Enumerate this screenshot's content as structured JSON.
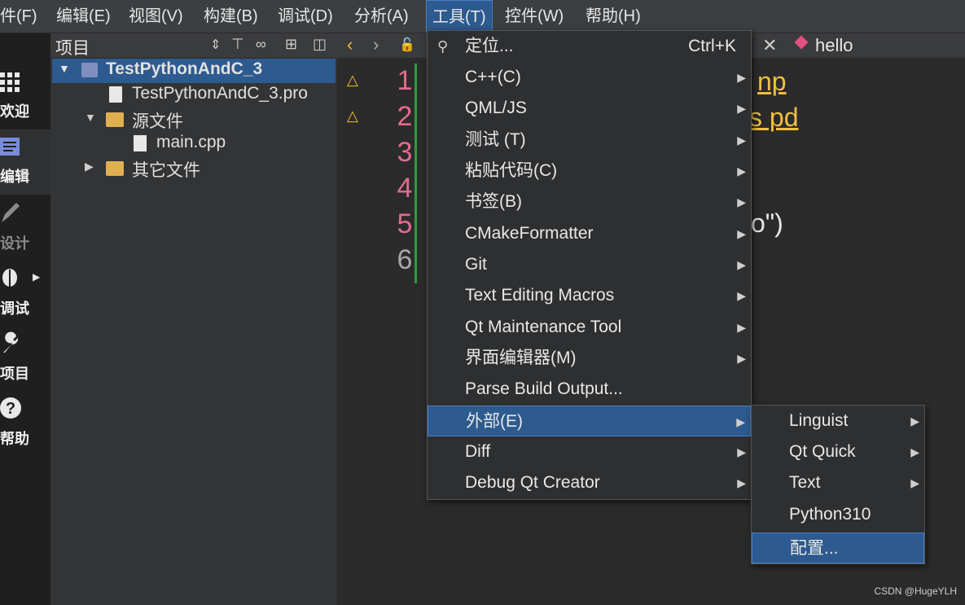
{
  "menubar": {
    "items": [
      "件(F)",
      "编辑(E)",
      "视图(V)",
      "构建(B)",
      "调试(D)",
      "分析(A)",
      "工具(T)",
      "控件(W)",
      "帮助(H)"
    ],
    "active": "工具(T)"
  },
  "modes": [
    "欢迎",
    "编辑",
    "设计",
    "调试",
    "项目",
    "帮助"
  ],
  "project_panel": {
    "title": "项目",
    "tree": [
      {
        "label": "TestPythonAndC_3",
        "level": 0,
        "icon": "project-folder-icon"
      },
      {
        "label": "TestPythonAndC_3.pro",
        "level": 1,
        "icon": "qt-file-icon"
      },
      {
        "label": "源文件",
        "level": 1,
        "icon": "source-folder-icon"
      },
      {
        "label": "main.cpp",
        "level": 2,
        "icon": "file-icon"
      },
      {
        "label": "其它文件",
        "level": 1,
        "icon": "other-folder-icon"
      }
    ]
  },
  "editor": {
    "tab_title": "hello",
    "line_numbers": [
      "1",
      "2",
      "3",
      "4",
      "5",
      "6"
    ],
    "code_fragments": [
      "np",
      "s  pd",
      "o\")"
    ]
  },
  "tools_menu": {
    "items": [
      {
        "label": "定位...",
        "shortcut": "Ctrl+K",
        "submenu": false
      },
      {
        "label": "C++(C)",
        "submenu": true
      },
      {
        "label": "QML/JS",
        "submenu": true
      },
      {
        "label": "测试 (T)",
        "submenu": true
      },
      {
        "label": "粘贴代码(C)",
        "submenu": true
      },
      {
        "label": "书签(B)",
        "submenu": true
      },
      {
        "label": "CMakeFormatter",
        "submenu": true
      },
      {
        "label": "Git",
        "submenu": true
      },
      {
        "label": "Text Editing Macros",
        "submenu": true
      },
      {
        "label": "Qt Maintenance Tool",
        "submenu": true
      },
      {
        "label": "界面编辑器(M)",
        "submenu": true
      },
      {
        "label": "Parse Build Output...",
        "submenu": false
      },
      {
        "label": "外部(E)",
        "submenu": true,
        "highlighted": true
      },
      {
        "label": "Diff",
        "submenu": true
      },
      {
        "label": "Debug Qt Creator",
        "submenu": true
      }
    ]
  },
  "external_submenu": {
    "items": [
      {
        "label": "Linguist",
        "submenu": true
      },
      {
        "label": "Qt Quick",
        "submenu": true
      },
      {
        "label": "Text",
        "submenu": true
      },
      {
        "label": "Python310",
        "submenu": false
      },
      {
        "label": "配置...",
        "submenu": false,
        "highlighted": true
      }
    ]
  },
  "watermark": "CSDN @HugeYLH"
}
